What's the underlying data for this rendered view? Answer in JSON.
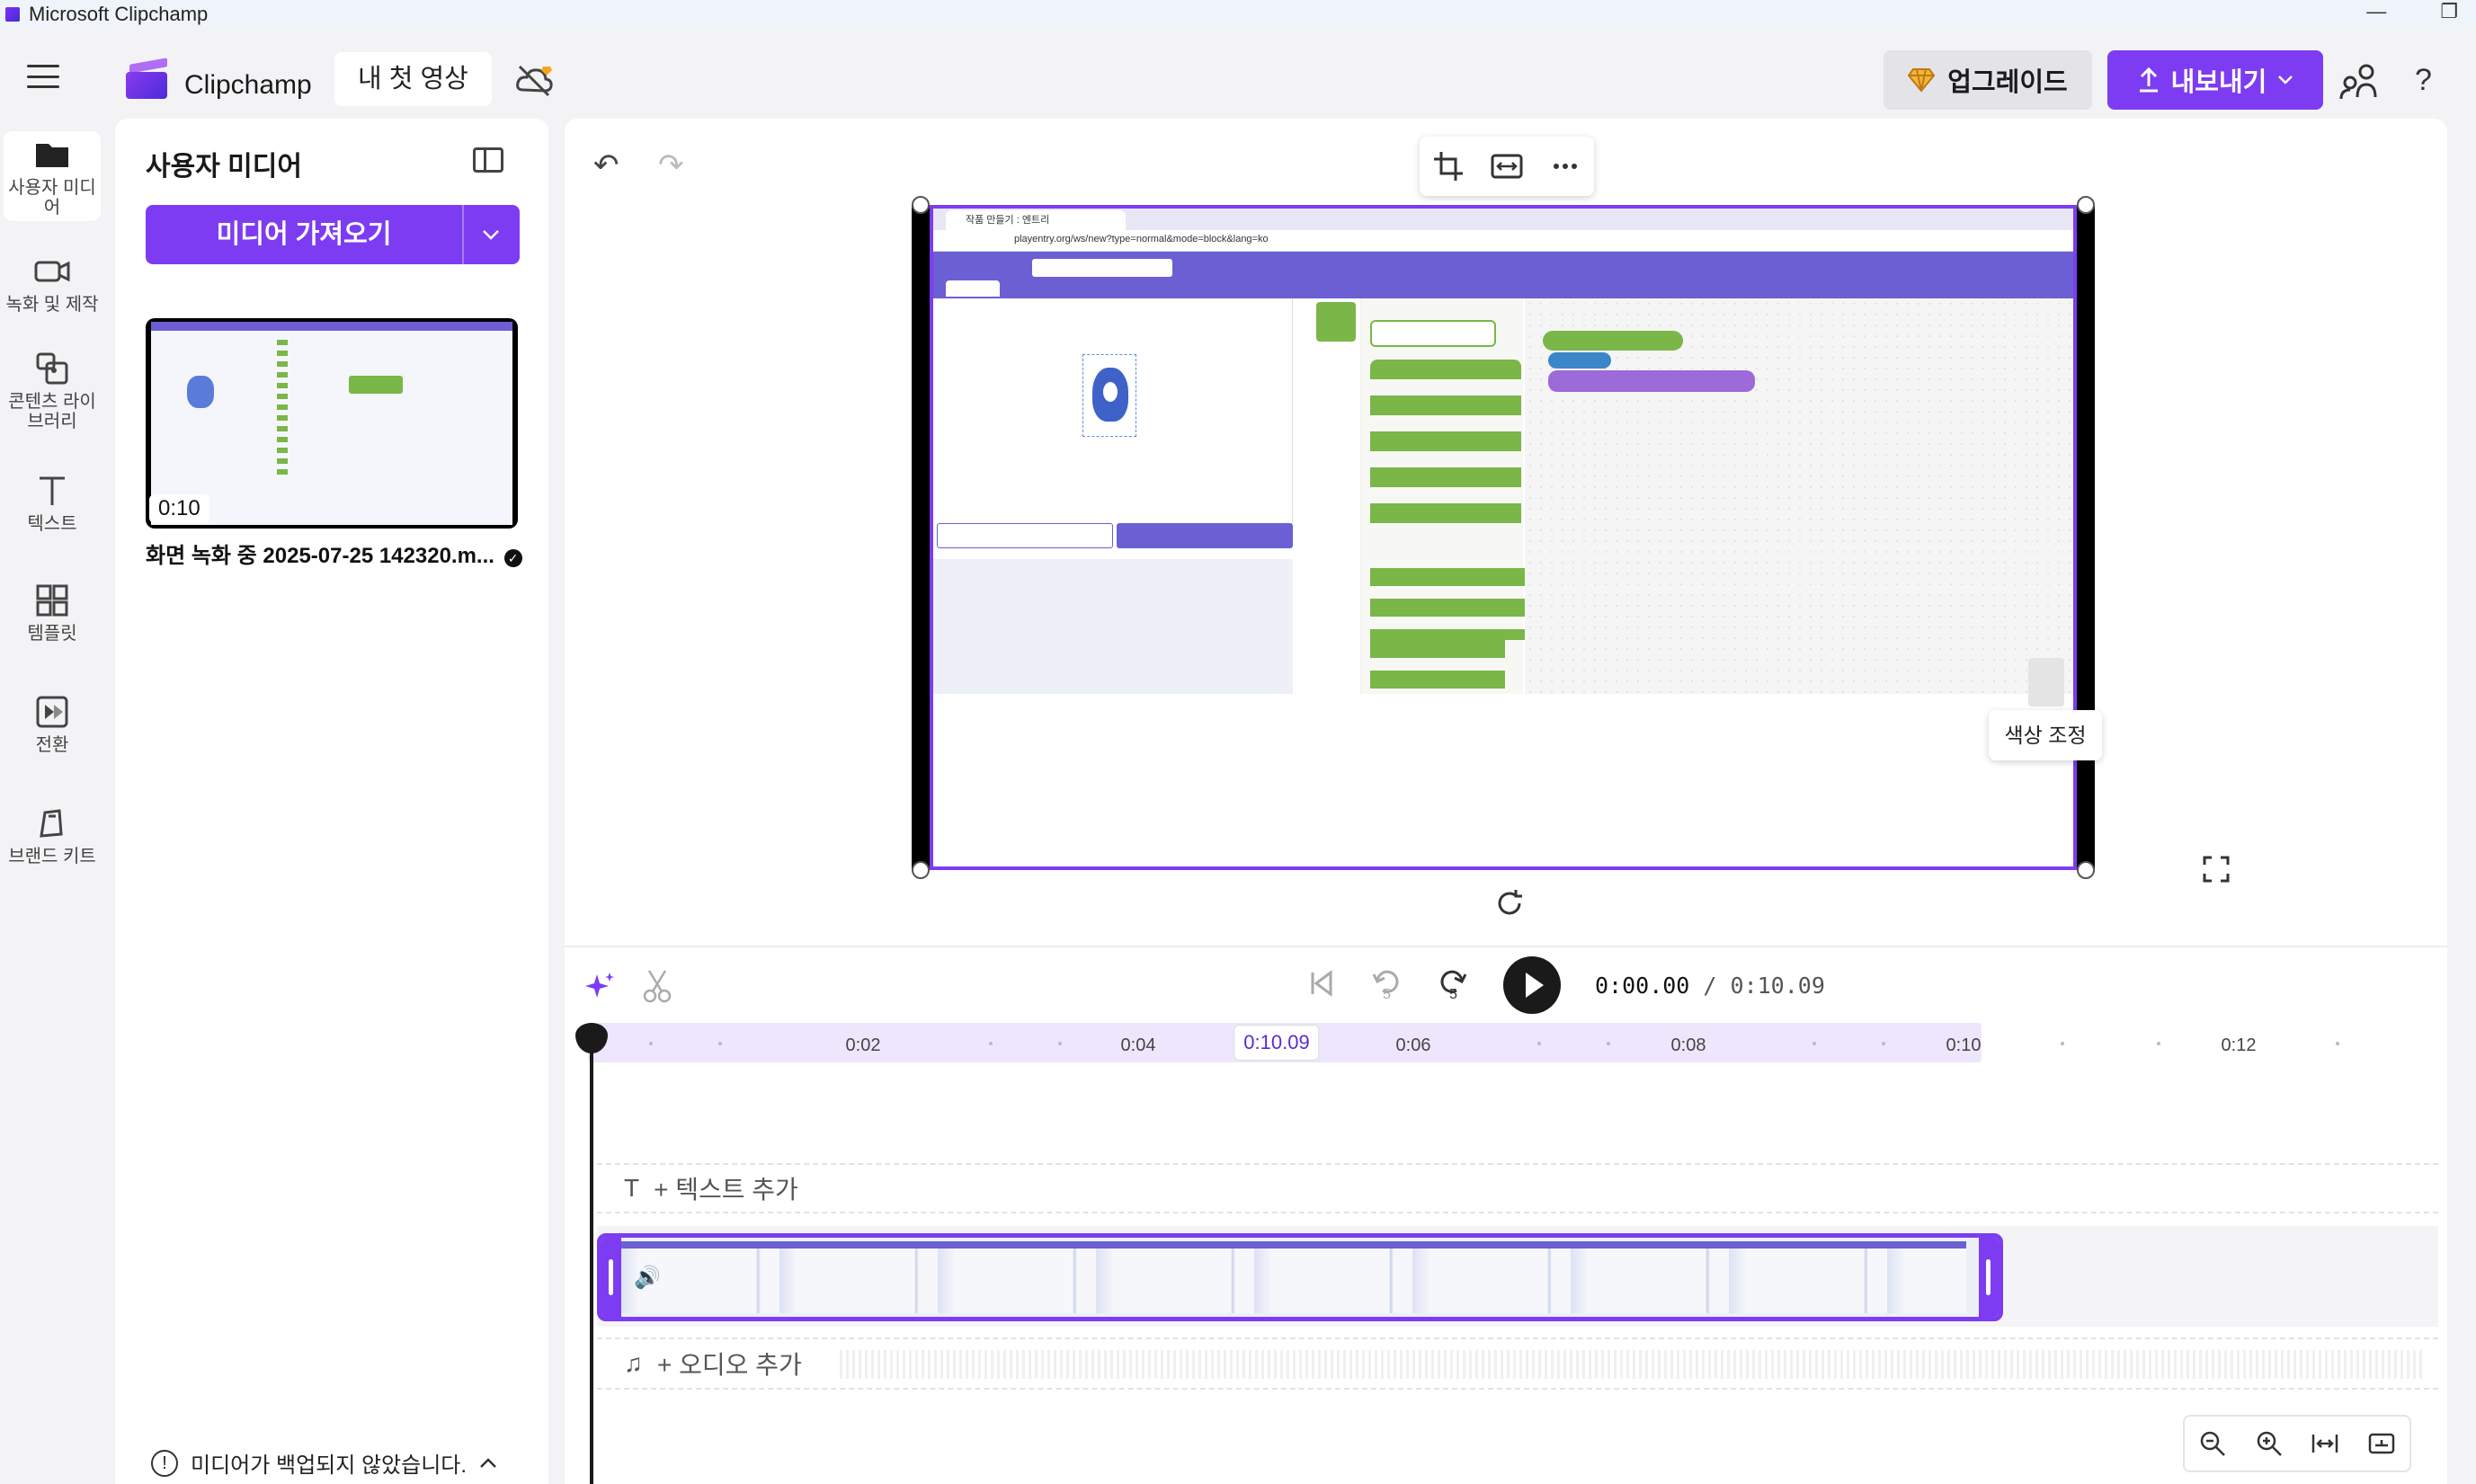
{
  "window": {
    "title": "Microsoft Clipchamp",
    "minimize": "—",
    "maximize": "❐"
  },
  "header": {
    "brand": "Clipchamp",
    "project_name": "내 첫 영상",
    "upgrade_label": "업그레이드",
    "export_label": "내보내기",
    "help": "?"
  },
  "rail": {
    "items": [
      {
        "label": "사용자 미디어",
        "icon": "folder-icon"
      },
      {
        "label": "녹화 및 제작",
        "icon": "camera-icon"
      },
      {
        "label": "콘텐츠 라이브러리",
        "icon": "library-icon"
      },
      {
        "label": "텍스트",
        "icon": "text-icon"
      },
      {
        "label": "템플릿",
        "icon": "templates-icon"
      },
      {
        "label": "전환",
        "icon": "transitions-icon"
      },
      {
        "label": "브랜드 키트",
        "icon": "brand-kit-icon"
      }
    ]
  },
  "media": {
    "title": "사용자 미디어",
    "import_label": "미디어 가져오기",
    "items": [
      {
        "name": "화면 녹화 중 2025-07-25 142320.m...",
        "duration": "0:10"
      }
    ],
    "backup_warning": "미디어가 백업되지 않았습니다."
  },
  "editor": {
    "color_adjust_tooltip": "색상 조정",
    "preview": {
      "browser_tab": "작품 만들기 : 엔트리",
      "url": "playentry.org/ws/new?type=normal&mode=block&lang=ko"
    }
  },
  "timeline": {
    "current_time": "0:00.00",
    "total_time": "/ 0:10.09",
    "skip_back_seconds": "5",
    "skip_forward_seconds": "5",
    "playhead_label": "0:10.09",
    "ticks": [
      "0:02",
      "0:04",
      "0:06",
      "0:08",
      "0:10",
      "0:12"
    ],
    "add_text_label": "+ 텍스트 추가",
    "add_audio_label": "+ 오디오 추가"
  },
  "colors": {
    "accent": "#7d3cf2",
    "highlight": "#ede6fd"
  }
}
